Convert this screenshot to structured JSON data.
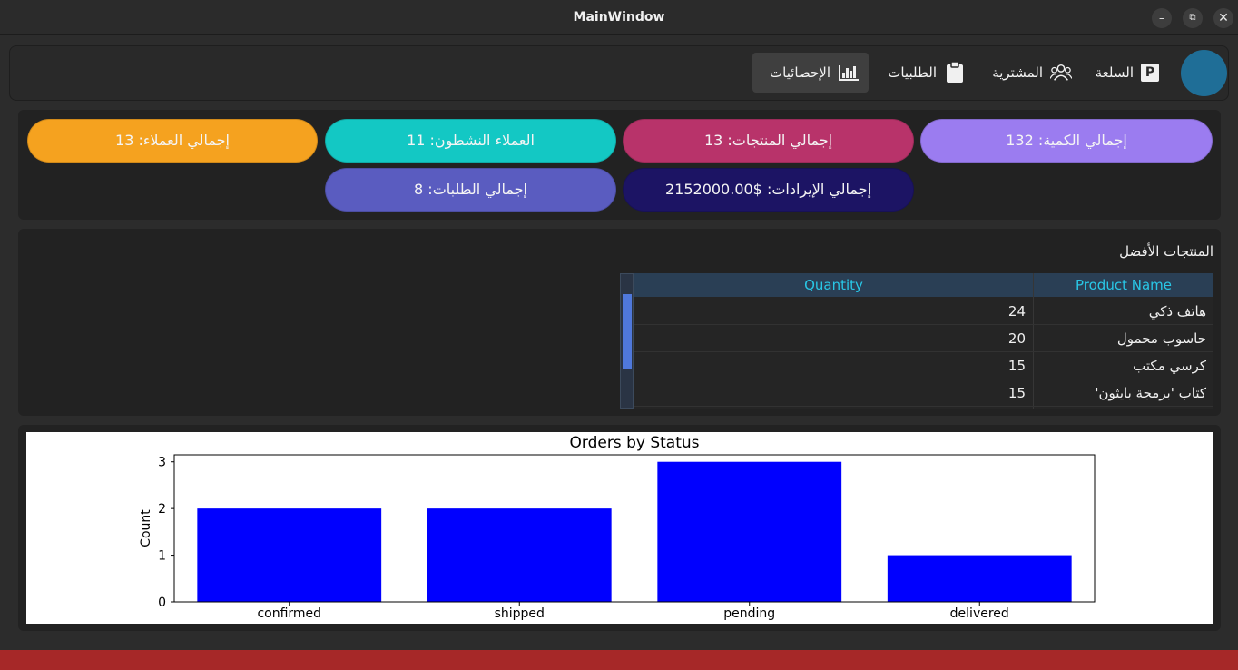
{
  "window": {
    "title": "MainWindow",
    "min": "–",
    "max": "⧉",
    "close": "✕"
  },
  "nav": {
    "items": [
      {
        "label": "الإحصائيات",
        "icon": "stats-icon"
      },
      {
        "label": "الطلبيات",
        "icon": "clipboard-icon"
      },
      {
        "label": "المشترية",
        "icon": "users-icon"
      },
      {
        "label": "السلعة",
        "icon": "product-p-icon"
      }
    ],
    "product_icon_letter": "P"
  },
  "stats": {
    "total_quantity": "إجمالي الكمية: 132",
    "total_products": "إجمالي المنتجات: 13",
    "active_customers": "العملاء النشطون: 11",
    "total_customers": "إجمالي العملاء: 13",
    "total_revenue": "إجمالي الإيرادات: $2152000.00",
    "total_orders": "إجمالي الطلبات: 8",
    "colors": {
      "total_quantity": "#9b7cf0",
      "total_products": "#b8336a",
      "active_customers": "#13c8c4",
      "total_customers": "#f5a21f",
      "total_revenue": "#1c1464",
      "total_orders": "#5a5cc0"
    }
  },
  "top_products": {
    "title": "المنتجات الأفضل",
    "headers": {
      "product_name": "Product Name",
      "quantity": "Quantity"
    },
    "rows": [
      {
        "name": "هاتف ذكي",
        "qty": "24"
      },
      {
        "name": "حاسوب محمول",
        "qty": "20"
      },
      {
        "name": "كرسي مكتب",
        "qty": "15"
      },
      {
        "name": "كتاب 'برمجة بايثون'",
        "qty": "15"
      }
    ]
  },
  "chart_data": {
    "type": "bar",
    "title": "Orders by Status",
    "xlabel": "",
    "ylabel": "Count",
    "categories": [
      "confirmed",
      "shipped",
      "pending",
      "delivered"
    ],
    "values": [
      2,
      2,
      3,
      1
    ],
    "ylim": [
      0,
      3.15
    ],
    "yticks": [
      0,
      1,
      2,
      3
    ],
    "bar_color": "#0000ff",
    "grid": false
  }
}
